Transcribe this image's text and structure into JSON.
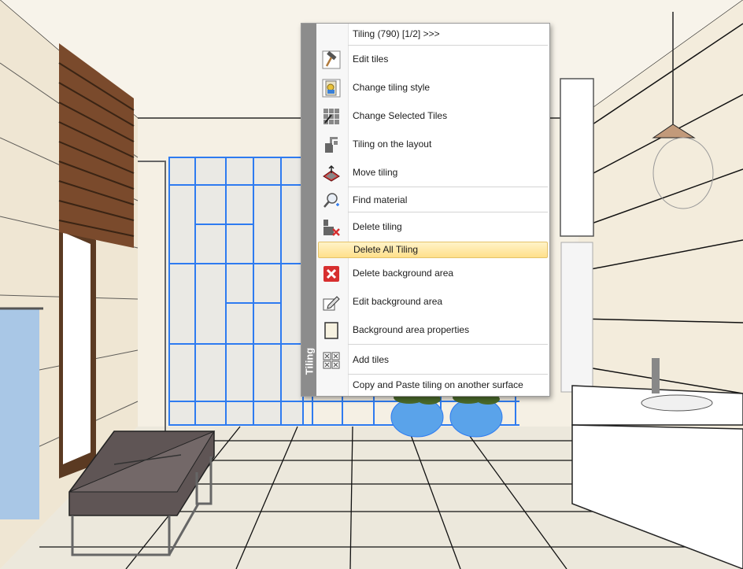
{
  "menu": {
    "sidebar_label": "Tiling",
    "header": "Tiling (790) [1/2] >>>",
    "items": [
      {
        "label": "Edit tiles",
        "icon": "hammer-icon"
      },
      {
        "label": "Change tiling style",
        "icon": "tiling-style-icon"
      },
      {
        "label": "Change Selected Tiles",
        "icon": "selected-tiles-icon"
      },
      {
        "label": "Tiling on the layout",
        "icon": "layout-tiling-icon"
      },
      {
        "label": "Move tiling",
        "icon": "move-tiling-icon"
      },
      {
        "label": "Find material",
        "icon": "magnifier-icon"
      },
      {
        "label": "Delete tiling",
        "icon": "delete-tiling-icon"
      },
      {
        "label": "Delete All Tiling",
        "icon": ""
      },
      {
        "label": "Delete background area",
        "icon": "red-x-icon"
      },
      {
        "label": "Edit background area",
        "icon": "pencil-area-icon"
      },
      {
        "label": "Background area properties",
        "icon": "properties-icon"
      },
      {
        "label": "Add tiles",
        "icon": "add-tiles-icon"
      },
      {
        "label": "Copy and Paste tiling on another surface",
        "icon": ""
      }
    ],
    "highlighted_item": "Delete All Tiling"
  },
  "colors": {
    "selection_blue": "#2e7bf0",
    "menu_sidebar": "#8c8c8c",
    "highlight": "#ffe08a",
    "delete_red": "#d72f2f"
  }
}
